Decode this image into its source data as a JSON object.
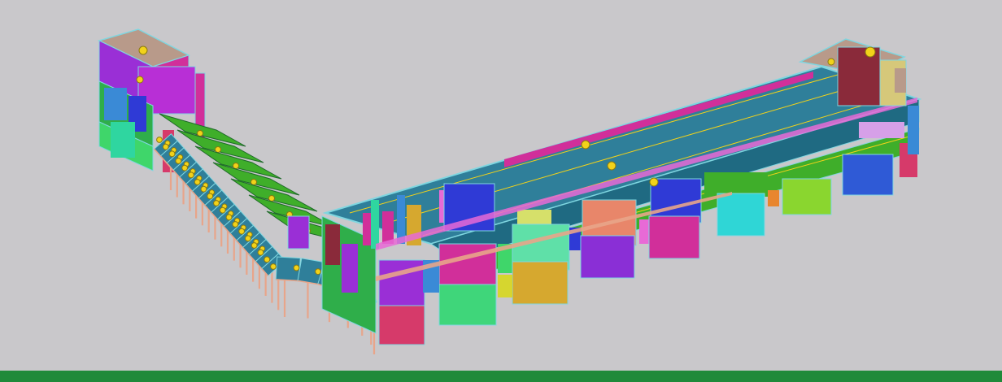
{
  "viewport": {
    "background": "#c9c8cb",
    "model": "building-structure-3d"
  },
  "bottom_bar": {
    "color": "#1f8a3a"
  },
  "palette": {
    "deck": "#2f7f9a",
    "deck_edge": "#7fd6e0",
    "slab_green": "#3fae2a",
    "column": "#e8a58a",
    "node": "#f2d21a",
    "magenta": "#d12f9a",
    "violet": "#9a2fd6",
    "blue": "#2f3ad6",
    "mint": "#5fe0a8",
    "cyan": "#2fd6d6",
    "lime": "#8ad62f",
    "rose": "#d63a6a",
    "orange": "#e8862f",
    "gold": "#d6a82f",
    "pink": "#e86ad6",
    "purple": "#8a2fd6",
    "brown": "#8a2a3a",
    "tan": "#b89a8a"
  }
}
